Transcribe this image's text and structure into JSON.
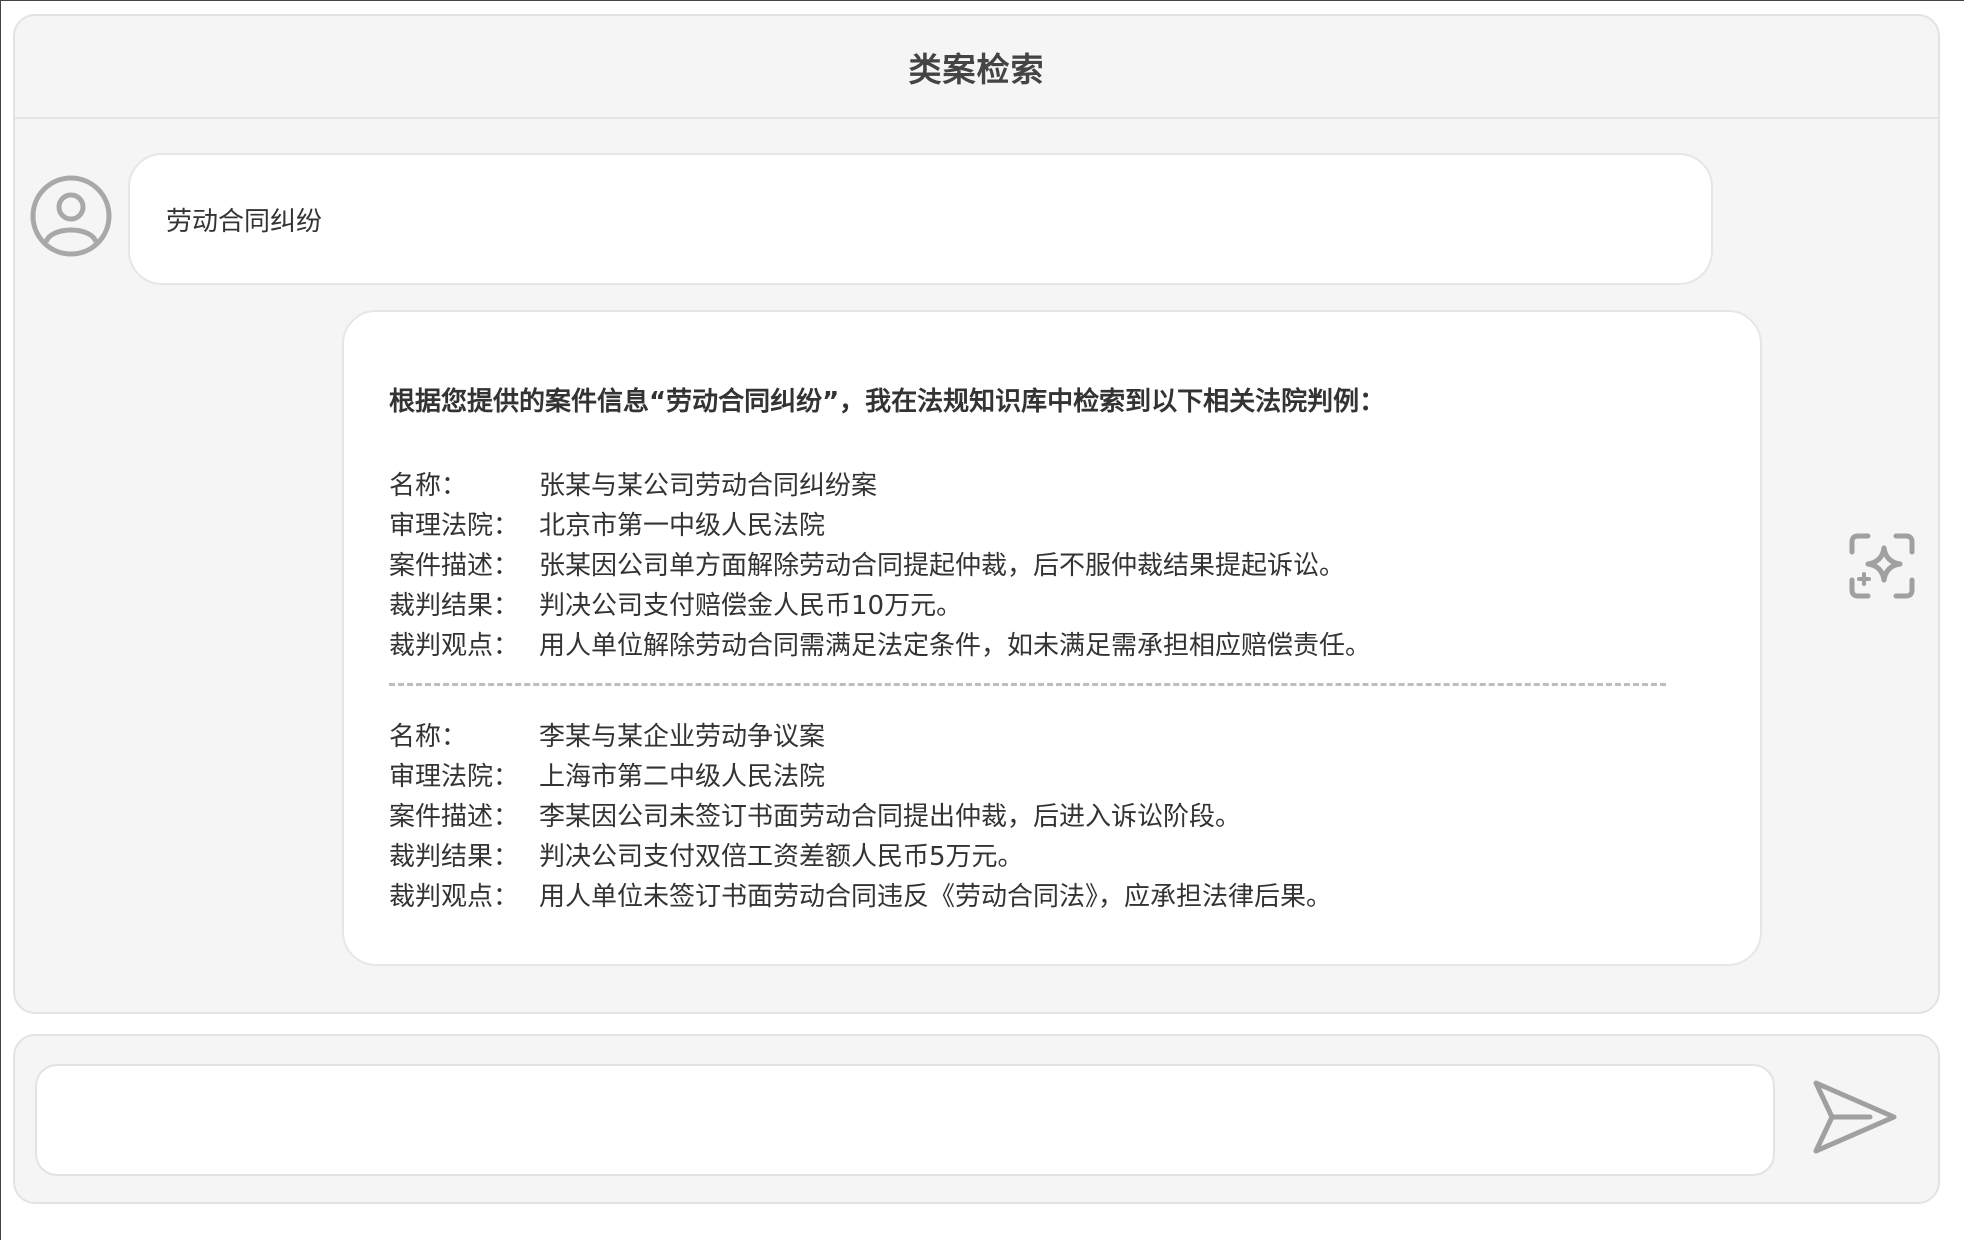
{
  "header": {
    "title": "类案检索"
  },
  "conversation": {
    "user_message": "劳动合同纠纷",
    "bot_intro": "根据您提供的案件信息“劳动合同纠纷”，我在法规知识库中检索到以下相关法院判例：",
    "cases": [
      {
        "name_label": "名称：",
        "name": "张某与某公司劳动合同纠纷案",
        "court_label": "审理法院：",
        "court": "北京市第一中级人民法院",
        "description_label": "案件描述：",
        "description": "张某因公司单方面解除劳动合同提起仲裁，后不服仲裁结果提起诉讼。",
        "result_label": "裁判结果：",
        "result": "判决公司支付赔偿金人民币10万元。",
        "viewpoint_label": "裁判观点：",
        "viewpoint": "用人单位解除劳动合同需满足法定条件，如未满足需承担相应赔偿责任。"
      },
      {
        "name_label": "名称：",
        "name": "李某与某企业劳动争议案",
        "court_label": "审理法院：",
        "court": "上海市第二中级人民法院",
        "description_label": "案件描述：",
        "description": "李某因公司未签订书面劳动合同提出仲裁，后进入诉讼阶段。",
        "result_label": "裁判结果：",
        "result": "判决公司支付双倍工资差额人民币5万元。",
        "viewpoint_label": "裁判观点：",
        "viewpoint": "用人单位未签订书面劳动合同违反《劳动合同法》，应承担法律后果。"
      }
    ]
  },
  "input": {
    "value": "",
    "placeholder": ""
  },
  "icons": {
    "avatar": "user-avatar-icon",
    "ai": "ai-sparkle-icon",
    "send": "send-icon"
  },
  "colors": {
    "panel_background": "#f5f5f5",
    "bubble_background": "#ffffff",
    "border": "#e3e3e3",
    "icon_gray": "#a0a0a0",
    "text": "#333333"
  }
}
